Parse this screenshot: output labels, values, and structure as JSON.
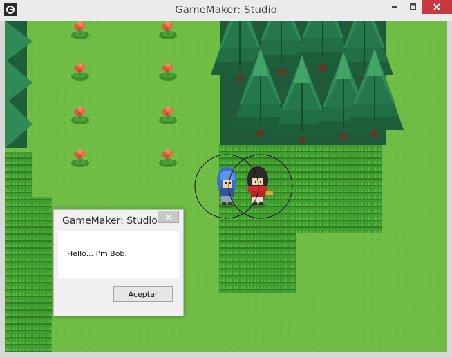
{
  "window": {
    "title": "GameMaker: Studio"
  },
  "dialog": {
    "title": "GameMaker: Studio",
    "message": "Hello... I'm Bob.",
    "ok_label": "Aceptar"
  },
  "colors": {
    "grass": "#6fbd45",
    "dense_grass": "#3f9b2f",
    "tree_dark": "#1f5a3a",
    "close_red": "#c7383f"
  },
  "icons": [
    "gamemaker-icon",
    "minimize-icon",
    "maximize-icon",
    "close-icon",
    "dialog-close-icon"
  ]
}
